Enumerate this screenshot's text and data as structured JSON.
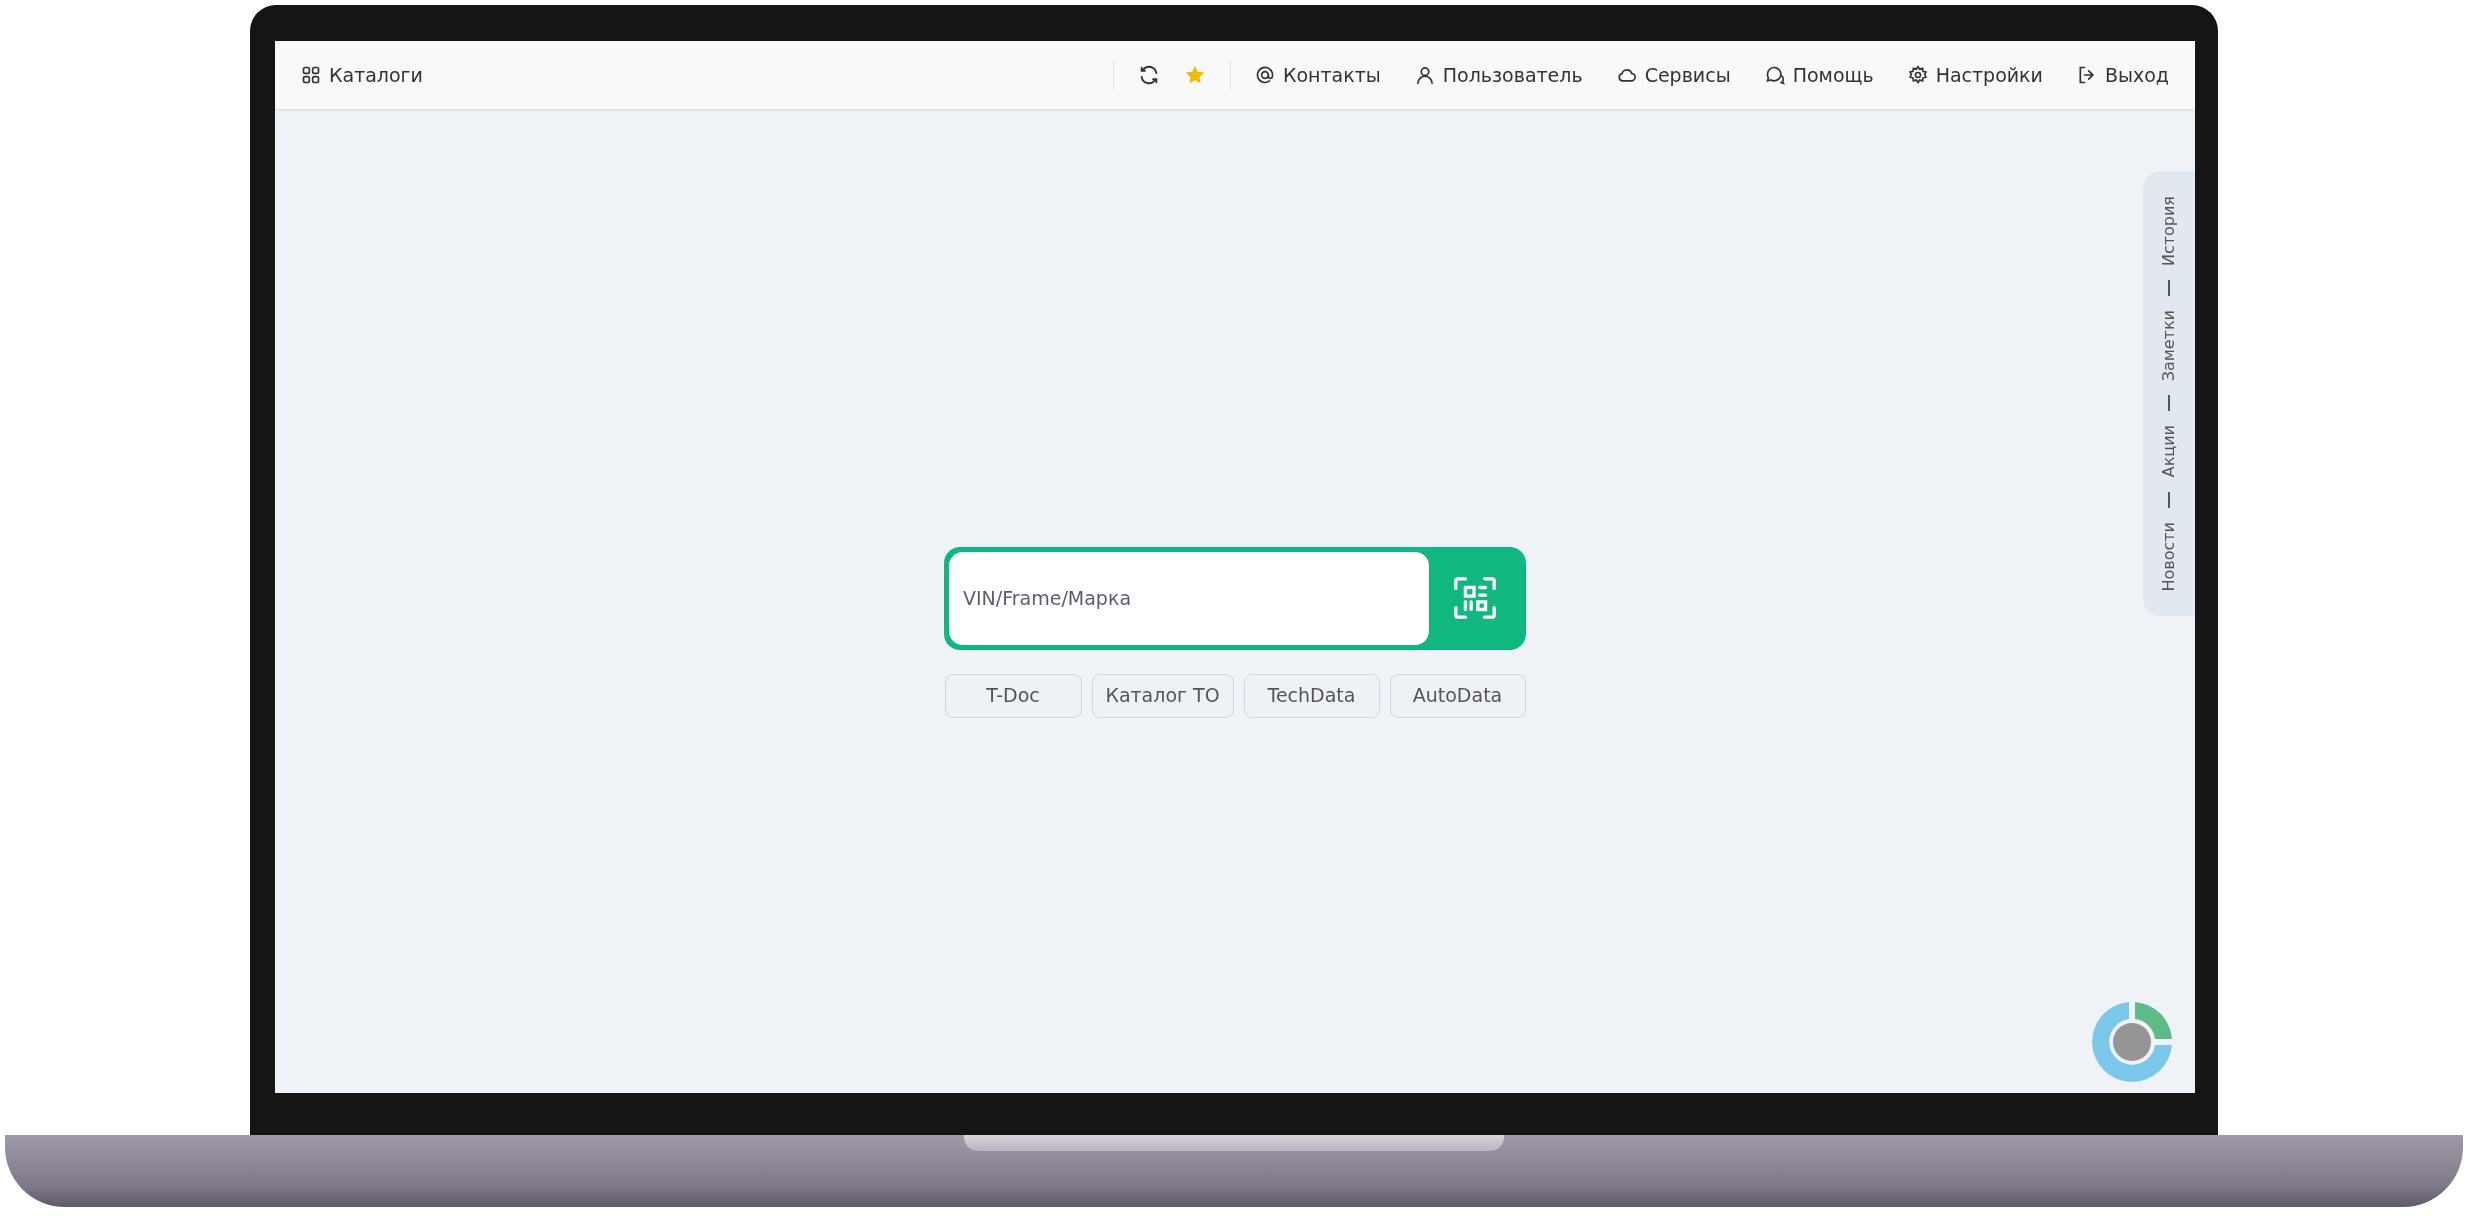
{
  "navbar": {
    "catalogs": "Каталоги",
    "links": [
      {
        "kind": "at",
        "label": "Контакты"
      },
      {
        "kind": "user",
        "label": "Пользователь"
      },
      {
        "kind": "cloud",
        "label": "Сервисы"
      },
      {
        "kind": "chat",
        "label": "Помощь"
      },
      {
        "kind": "gear",
        "label": "Настройки"
      },
      {
        "kind": "exit",
        "label": "Выход"
      }
    ]
  },
  "search": {
    "placeholder": "VIN/Frame/Марка"
  },
  "catalog_buttons": [
    "T-Doc",
    "Каталог TO",
    "TechData",
    "AutoData"
  ],
  "side_tabs": [
    "История",
    "Заметки",
    "Акции",
    "Новости"
  ]
}
